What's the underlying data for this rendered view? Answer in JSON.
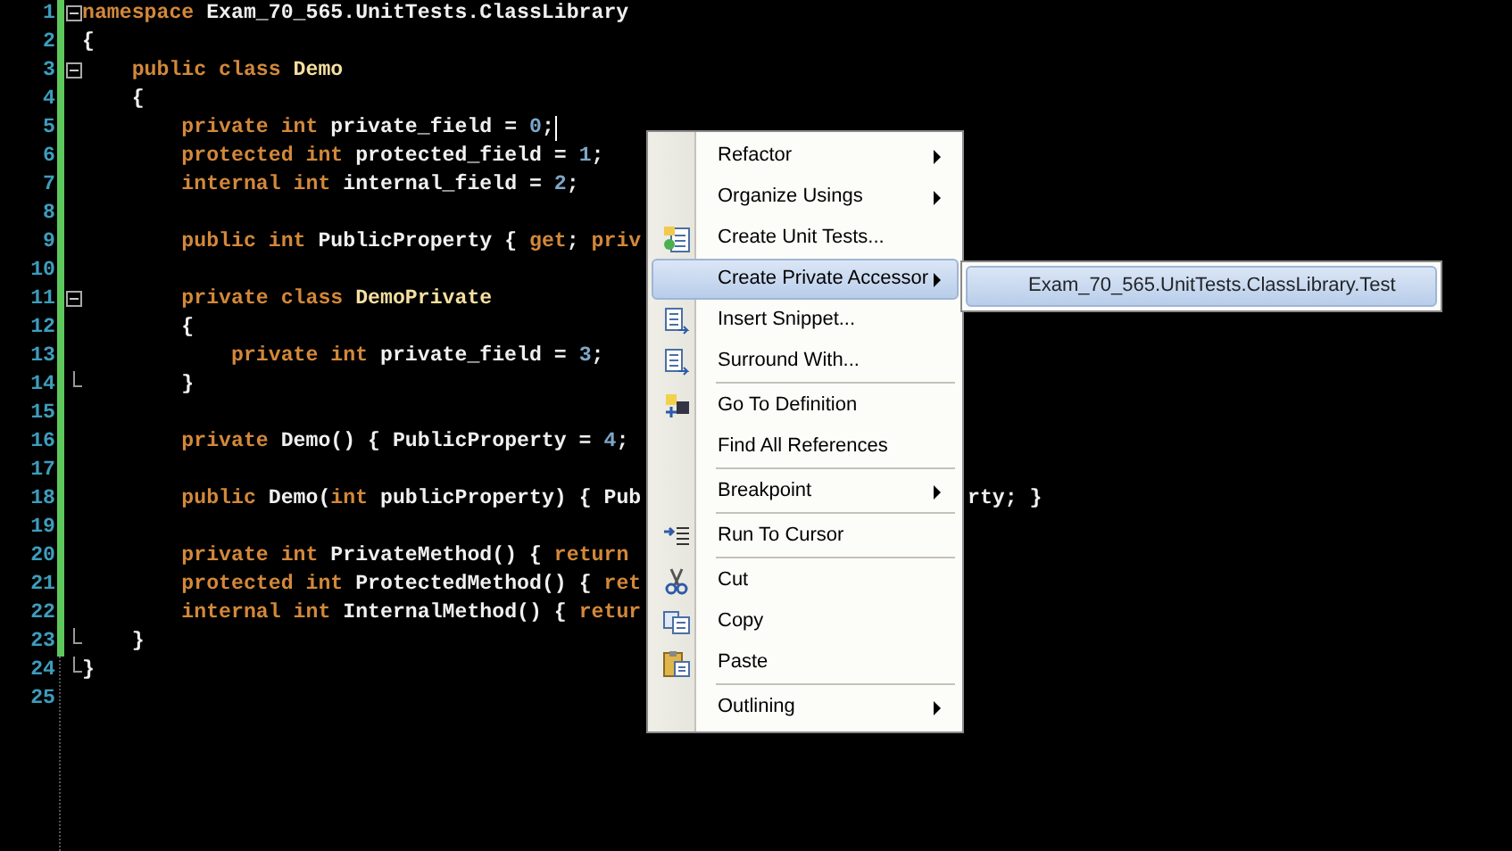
{
  "editor": {
    "lines": [
      {
        "number": "1",
        "fold_start": true,
        "fold_end": false,
        "caret": false,
        "tokens": [
          {
            "kind": "keyword",
            "text": "namespace"
          },
          {
            "kind": "plain",
            "text": " Exam_70_565.UnitTests.ClassLibrary"
          }
        ]
      },
      {
        "number": "2",
        "fold_start": false,
        "fold_end": false,
        "caret": false,
        "tokens": [
          {
            "kind": "plain",
            "text": "{"
          }
        ]
      },
      {
        "number": "3",
        "fold_start": true,
        "fold_end": false,
        "caret": false,
        "tokens": [
          {
            "kind": "keyword",
            "text": "    public class"
          },
          {
            "kind": "type",
            "text": " Demo"
          }
        ]
      },
      {
        "number": "4",
        "fold_start": false,
        "fold_end": false,
        "caret": false,
        "tokens": [
          {
            "kind": "plain",
            "text": "    {"
          }
        ]
      },
      {
        "number": "5",
        "fold_start": false,
        "fold_end": false,
        "caret": true,
        "tokens": [
          {
            "kind": "keyword",
            "text": "        private int"
          },
          {
            "kind": "plain",
            "text": " private_field = "
          },
          {
            "kind": "number",
            "text": "0"
          },
          {
            "kind": "plain",
            "text": ";"
          }
        ]
      },
      {
        "number": "6",
        "fold_start": false,
        "fold_end": false,
        "caret": false,
        "tokens": [
          {
            "kind": "keyword",
            "text": "        protected int"
          },
          {
            "kind": "plain",
            "text": " protected_field = "
          },
          {
            "kind": "number",
            "text": "1"
          },
          {
            "kind": "plain",
            "text": ";"
          }
        ]
      },
      {
        "number": "7",
        "fold_start": false,
        "fold_end": false,
        "caret": false,
        "tokens": [
          {
            "kind": "keyword",
            "text": "        internal int"
          },
          {
            "kind": "plain",
            "text": " internal_field = "
          },
          {
            "kind": "number",
            "text": "2"
          },
          {
            "kind": "plain",
            "text": ";"
          }
        ]
      },
      {
        "number": "8",
        "fold_start": false,
        "fold_end": false,
        "caret": false
      },
      {
        "number": "9",
        "fold_start": false,
        "fold_end": false,
        "caret": false,
        "tokens": [
          {
            "kind": "keyword",
            "text": "        public int"
          },
          {
            "kind": "plain",
            "text": " PublicProperty { "
          },
          {
            "kind": "keyword",
            "text": "get"
          },
          {
            "kind": "plain",
            "text": "; "
          },
          {
            "kind": "keyword",
            "text": "priv"
          }
        ]
      },
      {
        "number": "10",
        "fold_start": false,
        "fold_end": false,
        "caret": false
      },
      {
        "number": "11",
        "fold_start": true,
        "fold_end": false,
        "caret": false,
        "tokens": [
          {
            "kind": "keyword",
            "text": "        private class"
          },
          {
            "kind": "type",
            "text": " DemoPrivate"
          }
        ]
      },
      {
        "number": "12",
        "fold_start": false,
        "fold_end": false,
        "caret": false,
        "tokens": [
          {
            "kind": "plain",
            "text": "        {"
          }
        ]
      },
      {
        "number": "13",
        "fold_start": false,
        "fold_end": false,
        "caret": false,
        "tokens": [
          {
            "kind": "keyword",
            "text": "            private int"
          },
          {
            "kind": "plain",
            "text": " private_field = "
          },
          {
            "kind": "number",
            "text": "3"
          },
          {
            "kind": "plain",
            "text": ";"
          }
        ]
      },
      {
        "number": "14",
        "fold_start": false,
        "fold_end": true,
        "caret": false,
        "tokens": [
          {
            "kind": "plain",
            "text": "        }"
          }
        ]
      },
      {
        "number": "15",
        "fold_start": false,
        "fold_end": false,
        "caret": false
      },
      {
        "number": "16",
        "fold_start": false,
        "fold_end": false,
        "caret": false,
        "tokens": [
          {
            "kind": "keyword",
            "text": "        private"
          },
          {
            "kind": "plain",
            "text": " Demo() { PublicProperty = "
          },
          {
            "kind": "number",
            "text": "4"
          },
          {
            "kind": "plain",
            "text": ";"
          }
        ]
      },
      {
        "number": "17",
        "fold_start": false,
        "fold_end": false,
        "caret": false
      },
      {
        "number": "18",
        "fold_start": false,
        "fold_end": false,
        "caret": false,
        "tokens": [
          {
            "kind": "keyword",
            "text": "        public"
          },
          {
            "kind": "plain",
            "text": " Demo("
          },
          {
            "kind": "keyword",
            "text": "int"
          },
          {
            "kind": "plain",
            "text": " publicProperty) { Pub"
          }
        ],
        "tail": "rty; }"
      },
      {
        "number": "19",
        "fold_start": false,
        "fold_end": false,
        "caret": false
      },
      {
        "number": "20",
        "fold_start": false,
        "fold_end": false,
        "caret": false,
        "tokens": [
          {
            "kind": "keyword",
            "text": "        private int"
          },
          {
            "kind": "plain",
            "text": " PrivateMethod() { "
          },
          {
            "kind": "keyword",
            "text": "return"
          }
        ]
      },
      {
        "number": "21",
        "fold_start": false,
        "fold_end": false,
        "caret": false,
        "tokens": [
          {
            "kind": "keyword",
            "text": "        protected int"
          },
          {
            "kind": "plain",
            "text": " ProtectedMethod() { "
          },
          {
            "kind": "keyword",
            "text": "ret"
          }
        ]
      },
      {
        "number": "22",
        "fold_start": false,
        "fold_end": false,
        "caret": false,
        "tokens": [
          {
            "kind": "keyword",
            "text": "        internal int"
          },
          {
            "kind": "plain",
            "text": " InternalMethod() { "
          },
          {
            "kind": "keyword",
            "text": "retur"
          }
        ]
      },
      {
        "number": "23",
        "fold_start": false,
        "fold_end": true,
        "caret": false,
        "tokens": [
          {
            "kind": "plain",
            "text": "    }"
          }
        ]
      },
      {
        "number": "24",
        "fold_start": false,
        "fold_end": true,
        "caret": false,
        "tokens": [
          {
            "kind": "plain",
            "text": "}"
          }
        ]
      },
      {
        "number": "25",
        "fold_start": false,
        "fold_end": false,
        "caret": false
      }
    ]
  },
  "context_menu": {
    "items": [
      {
        "kind": "item",
        "label": "Refactor",
        "has_submenu": true,
        "selected": false
      },
      {
        "kind": "item",
        "label": "Organize Usings",
        "has_submenu": true,
        "selected": false
      },
      {
        "kind": "item",
        "label": "Create Unit Tests...",
        "has_submenu": false,
        "selected": false
      },
      {
        "kind": "item",
        "label": "Create Private Accessor",
        "has_submenu": true,
        "selected": true
      },
      {
        "kind": "item",
        "label": "Insert Snippet...",
        "has_submenu": false,
        "selected": false
      },
      {
        "kind": "item",
        "label": "Surround With...",
        "has_submenu": false,
        "selected": false
      },
      {
        "kind": "separator"
      },
      {
        "kind": "item",
        "label": "Go To Definition",
        "has_submenu": false,
        "selected": false
      },
      {
        "kind": "item",
        "label": "Find All References",
        "has_submenu": false,
        "selected": false
      },
      {
        "kind": "separator"
      },
      {
        "kind": "item",
        "label": "Breakpoint",
        "has_submenu": true,
        "selected": false
      },
      {
        "kind": "separator"
      },
      {
        "kind": "item",
        "label": "Run To Cursor",
        "has_submenu": false,
        "selected": false
      },
      {
        "kind": "separator"
      },
      {
        "kind": "item",
        "label": "Cut",
        "has_submenu": false,
        "selected": false
      },
      {
        "kind": "item",
        "label": "Copy",
        "has_submenu": false,
        "selected": false
      },
      {
        "kind": "item",
        "label": "Paste",
        "has_submenu": false,
        "selected": false
      },
      {
        "kind": "separator"
      },
      {
        "kind": "item",
        "label": "Outlining",
        "has_submenu": true,
        "selected": false
      }
    ]
  },
  "submenu": {
    "items": [
      {
        "label": "Exam_70_565.UnitTests.ClassLibrary.Test",
        "selected": true
      }
    ]
  }
}
